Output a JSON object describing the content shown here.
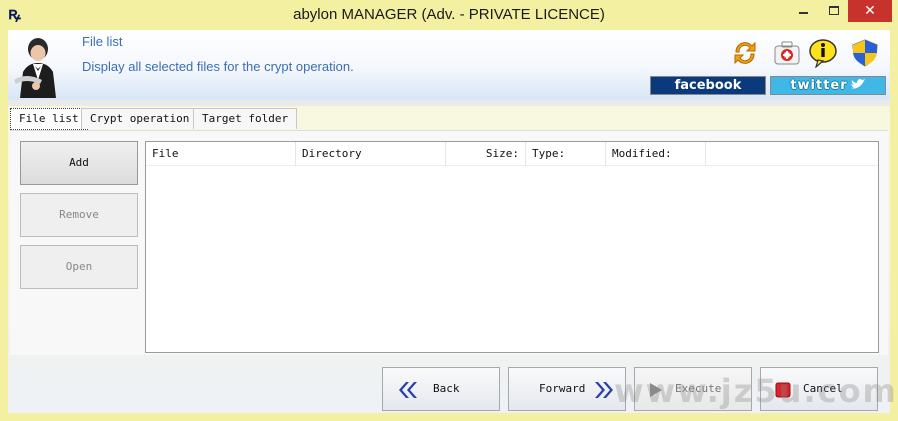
{
  "window": {
    "title": "abylon MANAGER (Adv. - PRIVATE LICENCE)",
    "minimize_glyph": "",
    "maximize_glyph": "",
    "close_glyph": "✕"
  },
  "header": {
    "title": "File list",
    "subtitle": "Display all selected files for the crypt operation.",
    "facebook_label": "facebook",
    "twitter_label": "twitter"
  },
  "tabs": [
    {
      "label": "File list",
      "active": true
    },
    {
      "label": "Crypt operation",
      "active": false
    },
    {
      "label": "Target folder",
      "active": false
    }
  ],
  "sidebar": {
    "add_label": "Add",
    "remove_label": "Remove",
    "open_label": "Open"
  },
  "table": {
    "columns": [
      "File",
      "Directory",
      "Size:",
      "Type:",
      "Modified:"
    ],
    "rows": []
  },
  "footer": {
    "back_label": "Back",
    "forward_label": "Forward",
    "execute_label": "Execute",
    "cancel_label": "Cancel"
  },
  "watermark": "www.jz5u.com",
  "colors": {
    "titlebar_bg": "#f3f0a2",
    "header_text": "#3a6fb5",
    "facebook_bg": "#0a3a7c",
    "twitter_bg": "#3fb8e8",
    "close_bg": "#c7322d",
    "accent_arrow": "#2a3fa8"
  }
}
